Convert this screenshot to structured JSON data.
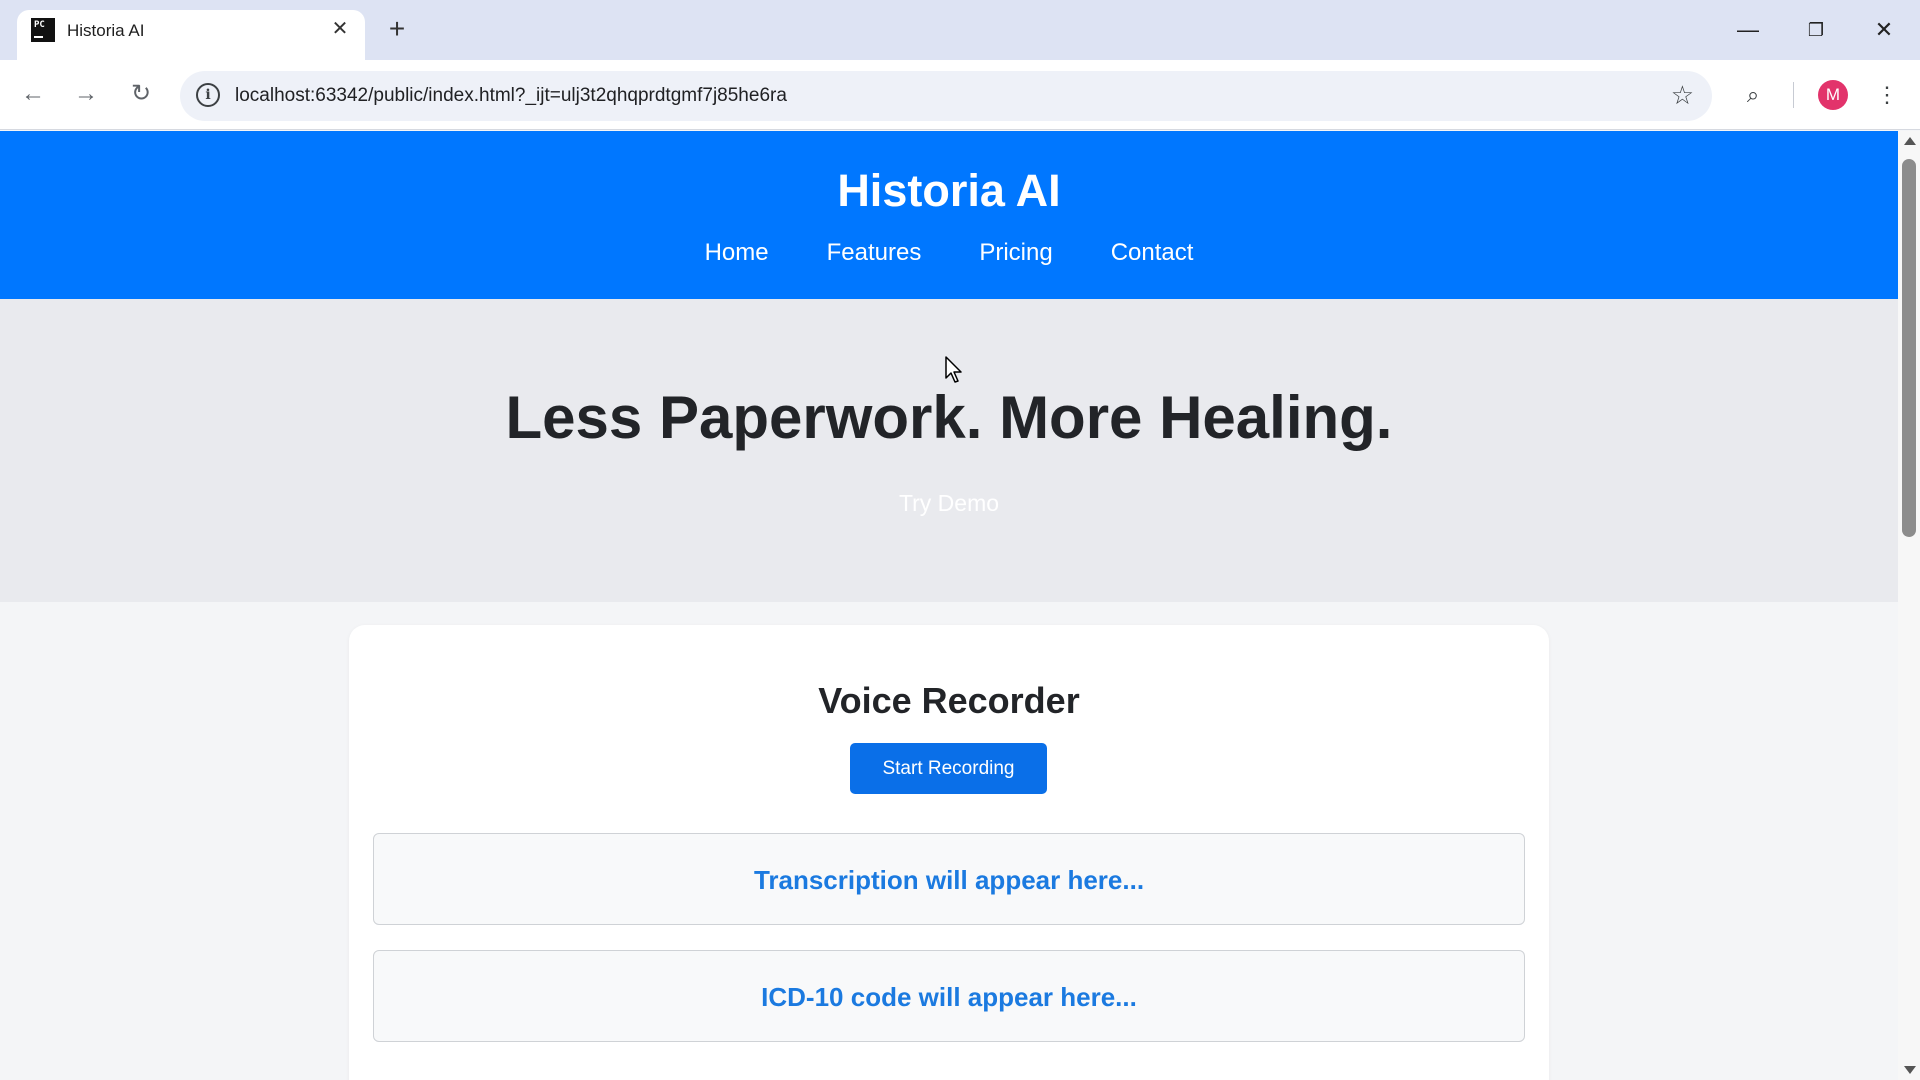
{
  "browser": {
    "tab_title": "Historia AI",
    "favicon_text": "PC",
    "url": "localhost:63342/public/index.html?_ijt=ulj3t2qhqprdtgmf7j85he6ra",
    "avatar_letter": "M"
  },
  "site": {
    "brand": "Historia AI",
    "nav": [
      "Home",
      "Features",
      "Pricing",
      "Contact"
    ],
    "hero_headline": "Less Paperwork. More Healing.",
    "hero_cta": "Try Demo"
  },
  "recorder": {
    "title": "Voice Recorder",
    "start_button": "Start Recording",
    "transcription_placeholder": "Transcription will appear here...",
    "icd_placeholder": "ICD-10 code will appear here..."
  },
  "colors": {
    "header_blue": "#0077ff",
    "hero_bg": "#e9eaee",
    "button_blue": "#0a6fe8",
    "output_text_blue": "#1b7ae0"
  }
}
